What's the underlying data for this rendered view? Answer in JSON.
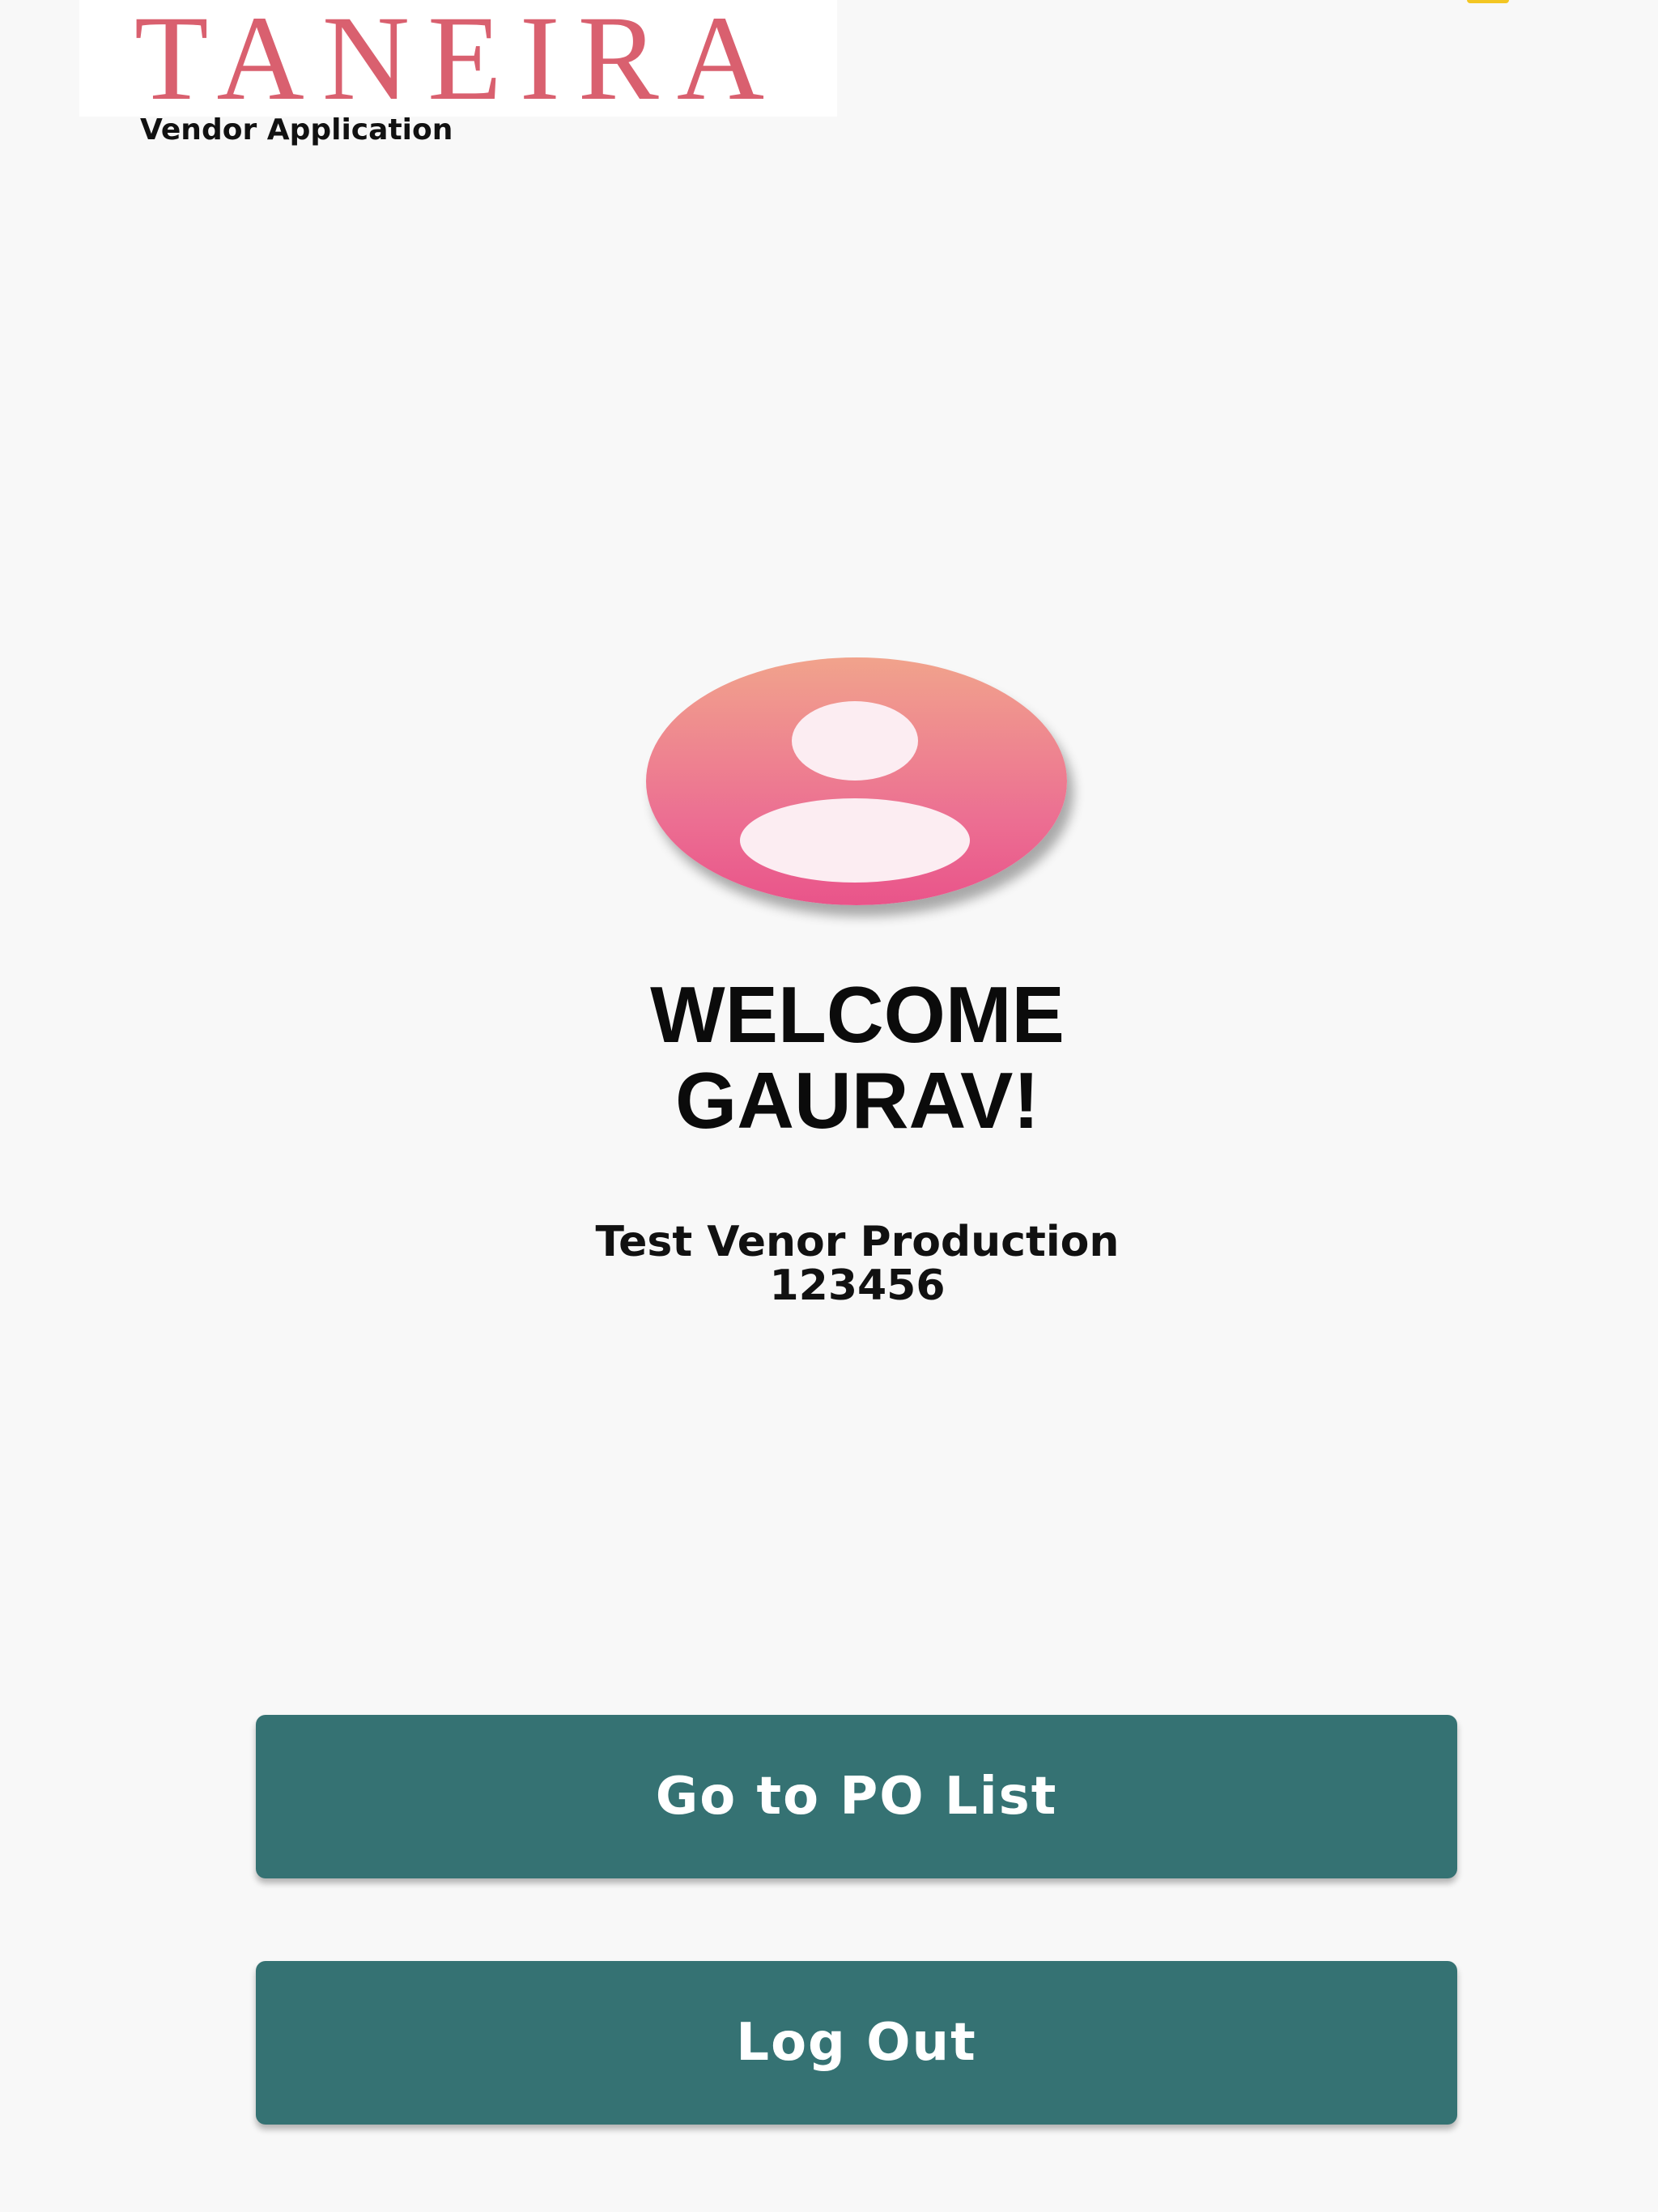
{
  "header": {
    "logo_text": "TANEIRA",
    "app_subtitle": "Vendor Application"
  },
  "profile": {
    "welcome_line1": "WELCOME",
    "welcome_line2": "GAURAV!",
    "vendor_name": "Test Venor Production",
    "vendor_code": "123456",
    "avatar_icon": "user-avatar-icon"
  },
  "actions": {
    "po_list_label": "Go to PO List",
    "logout_label": "Log Out"
  },
  "colors": {
    "background": "#f8f8f8",
    "brand_pink": "#d9606f",
    "button_teal": "#357273",
    "avatar_gradient_top": "#f1a38c",
    "avatar_gradient_bottom": "#e9548a",
    "status_yellow": "#f3c623"
  }
}
